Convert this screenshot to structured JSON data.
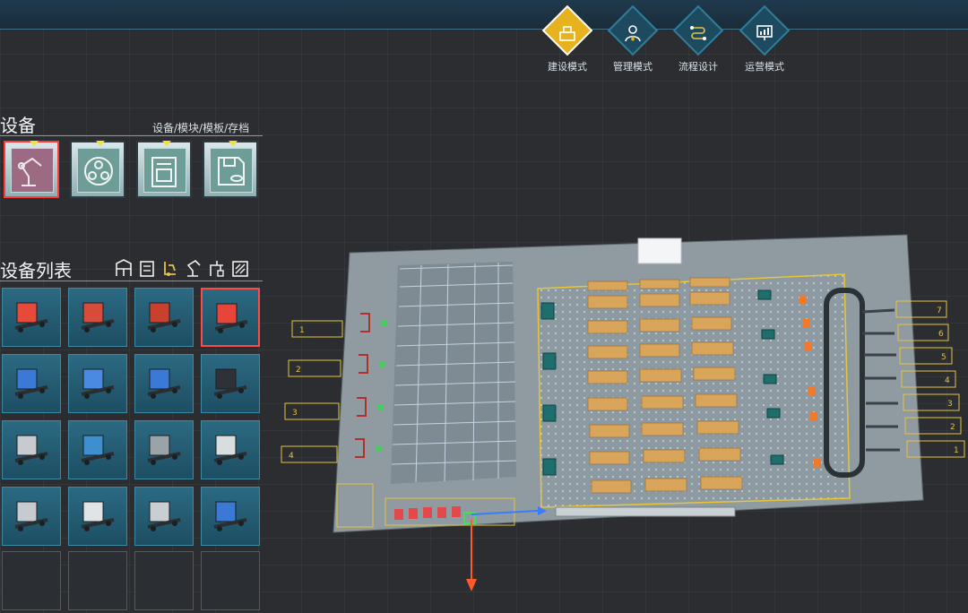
{
  "modes": [
    {
      "label": "建设模式",
      "icon": "build-icon",
      "active": true
    },
    {
      "label": "管理模式",
      "icon": "manager-icon",
      "active": false
    },
    {
      "label": "流程设计",
      "icon": "flow-icon",
      "active": false
    },
    {
      "label": "运营模式",
      "icon": "chart-icon",
      "active": false
    }
  ],
  "equipment": {
    "title": "设备",
    "subtitle": "设备/模块/模板/存档",
    "categories": [
      "robot-arm-icon",
      "module-icon",
      "template-icon",
      "save-icon"
    ]
  },
  "equipment_list": {
    "title": "设备列表",
    "tools": [
      "shelf-icon",
      "list-icon",
      "forklift-tool-icon",
      "arm-tool-icon",
      "crane-tool-icon",
      "conveyor-tool-icon"
    ],
    "items": [
      "pallet-jack-icon",
      "manual-stacker-icon",
      "forklift-icon",
      "electric-stacker-icon",
      "platform-trolley-icon",
      "shelf-cart-icon",
      "blue-cart-icon",
      "belt-conveyor-icon",
      "roller-conveyor-icon",
      "transfer-conveyor-icon",
      "sorting-conveyor-icon",
      "lift-icon",
      "stacker-crane-icon",
      "agv-small-icon",
      "agv-green-icon",
      "curve-conveyor-icon",
      "empty-slot",
      "empty-slot",
      "empty-slot",
      "empty-slot"
    ]
  },
  "scene": {
    "dock_left": [
      "1",
      "2",
      "3",
      "4"
    ],
    "dock_right": [
      "7",
      "6",
      "5",
      "4",
      "3",
      "2",
      "1"
    ]
  }
}
